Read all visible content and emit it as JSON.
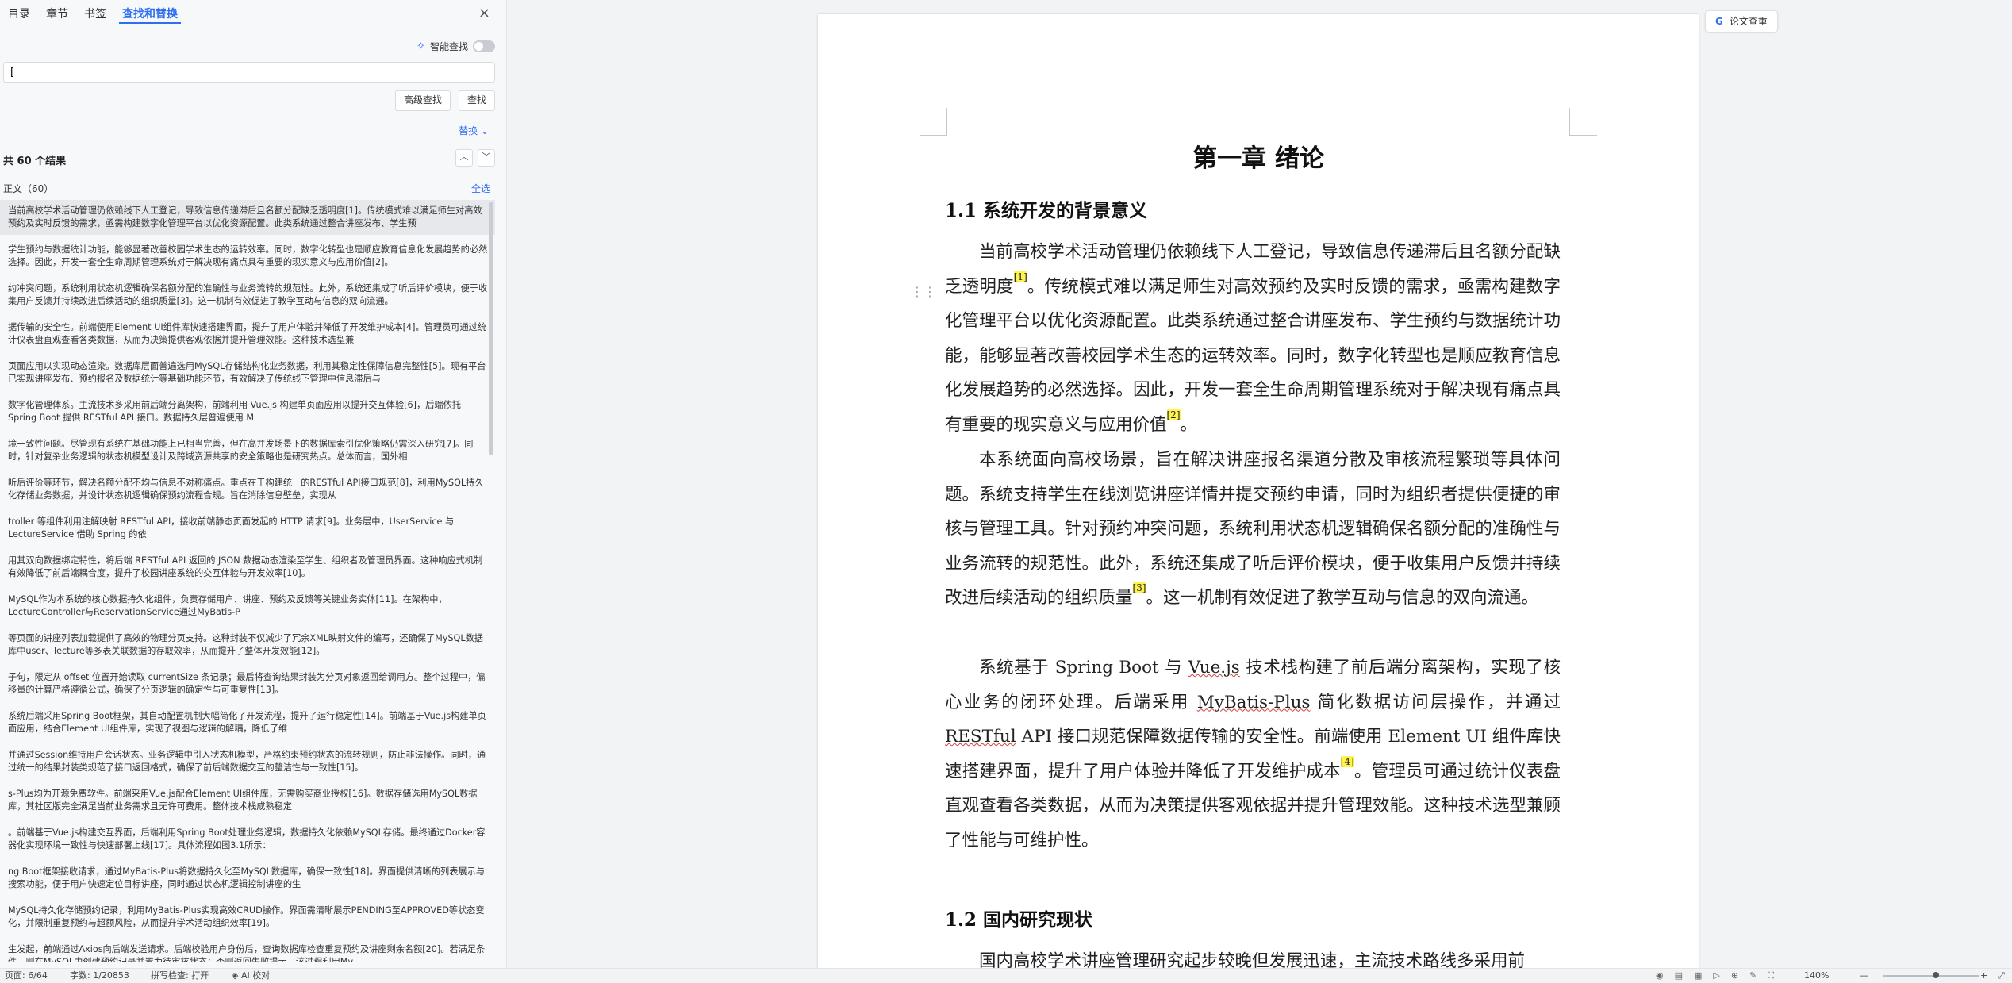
{
  "nav": {
    "tabs": [
      "目录",
      "章节",
      "书签",
      "查找和替换"
    ],
    "active_tab": "查找和替换",
    "close_icon": "×"
  },
  "search": {
    "smart_search_label": "智能查找",
    "query": "[",
    "advanced_label": "高级查找",
    "find_label": "查找",
    "replace_label": "替换",
    "result_count": "共 60 个结果",
    "section_label": "正文（60）",
    "select_all": "全选"
  },
  "results": [
    "当前高校学术活动管理仍依赖线下人工登记，导致信息传递滞后且名额分配缺乏透明度[1]。传统模式难以满足师生对高效预约及实时反馈的需求，亟需构建数字化管理平台以优化资源配置。此类系统通过整合讲座发布、学生预",
    "学生预约与数据统计功能，能够显著改善校园学术生态的运转效率。同时，数字化转型也是顺应教育信息化发展趋势的必然选择。因此，开发一套全生命周期管理系统对于解决现有痛点具有重要的现实意义与应用价值[2]。",
    "约冲突问题，系统利用状态机逻辑确保名额分配的准确性与业务流转的规范性。此外，系统还集成了听后评价模块，便于收集用户反馈并持续改进后续活动的组织质量[3]。这一机制有效促进了教学互动与信息的双向流通。",
    "据传输的安全性。前端使用Element UI组件库快速搭建界面，提升了用户体验并降低了开发维护成本[4]。管理员可通过统计仪表盘直观查看各类数据，从而为决策提供客观依据并提升管理效能。这种技术选型兼",
    "页面应用以实现动态渲染。数据库层面普遍选用MySQL存储结构化业务数据，利用其稳定性保障信息完整性[5]。现有平台已实现讲座发布、预约报名及数据统计等基础功能环节，有效解决了传统线下管理中信息滞后与",
    "数字化管理体系。主流技术多采用前后端分离架构，前端利用 Vue.js 构建单页面应用以提升交互体验[6]，后端依托 Spring Boot 提供 RESTful API 接口。数据持久层普遍使用 M",
    "境一致性问题。尽管现有系统在基础功能上已相当完善，但在高并发场景下的数据库索引优化策略仍需深入研究[7]。同时，针对复杂业务逻辑的状态机模型设计及跨域资源共享的安全策略也是研究热点。总体而言，国外相",
    "听后评价等环节，解决名额分配不均与信息不对称痛点。重点在于构建统一的RESTful API接口规范[8]，利用MySQL持久化存储业务数据，并设计状态机逻辑确保预约流程合规。旨在消除信息壁垒，实现从",
    "troller 等组件利用注解映射 RESTful API，接收前端静态页面发起的 HTTP 请求[9]。业务层中，UserService 与 LectureService 借助 Spring 的依",
    "用其双向数据绑定特性，将后端 RESTful API 返回的 JSON 数据动态渲染至学生、组织者及管理员界面。这种响应式机制有效降低了前后端耦合度，提升了校园讲座系统的交互体验与开发效率[10]。",
    "MySQL作为本系统的核心数据持久化组件，负责存储用户、讲座、预约及反馈等关键业务实体[11]。在架构中，LectureController与ReservationService通过MyBatis-P",
    "等页面的讲座列表加载提供了高效的物理分页支持。这种封装不仅减少了冗余XML映射文件的编写，还确保了MySQL数据库中user、lecture等多表关联数据的存取效率，从而提升了整体开发效能[12]。",
    "子句，限定从 offset 位置开始读取 currentSize 条记录；最后将查询结果封装为分页对象返回给调用方。整个过程中，偏移量的计算严格遵循公式，确保了分页逻辑的确定性与可重复性[13]。",
    "系统后端采用Spring Boot框架，其自动配置机制大幅简化了开发流程，提升了运行稳定性[14]。前端基于Vue.js构建单页面应用，结合Element UI组件库，实现了视图与逻辑的解耦，降低了维",
    "并通过Session维持用户会话状态。业务逻辑中引入状态机模型，严格约束预约状态的流转规则，防止非法操作。同时，通过统一的结果封装类规范了接口返回格式，确保了前后端数据交互的整洁性与一致性[15]。",
    "s-Plus均为开源免费软件。前端采用Vue.js配合Element UI组件库，无需购买商业授权[16]。数据存储选用MySQL数据库，其社区版完全满足当前业务需求且无许可费用。整体技术栈成熟稳定",
    "。前端基于Vue.js构建交互界面，后端利用Spring Boot处理业务逻辑，数据持久化依赖MySQL存储。最终通过Docker容器化实现环境一致性与快速部署上线[17]。具体流程如图3.1所示：",
    "ng Boot框架接收请求，通过MyBatis-Plus将数据持久化至MySQL数据库，确保一致性[18]。界面提供清晰的列表展示与搜索功能，便于用户快速定位目标讲座，同时通过状态机逻辑控制讲座的生",
    "MySQL持久化存储预约记录，利用MyBatis-Plus实现高效CRUD操作。界面需清晰展示PENDING至APPROVED等状态变化，并限制重复预约与超额风险，从而提升学术活动组织效率[19]。",
    "生发起，前端通过Axios向后端发送请求。后端校验用户身份后，查询数据库检查重复预约及讲座剩余名额[20]。若满足条件，则在MySQL中创建预约记录并置为待审核状态；否则返回失败提示。该过程利用My"
  ],
  "document": {
    "chapter_title": "第一章 绪论",
    "sec1_title": "1.1 系统开发的背景意义",
    "p1": [
      "当前高校学术活动管理仍依赖线下人工登记，导致信息传递滞后且名额分配缺乏透明度",
      "[1]",
      "。传统模式难以满足师生对高效预约及实时反馈的需求，亟需构建数字化管理平台以优化资源配置。此类系统通过整合讲座发布、学生预约与数据统计功能，能够显著改善校园学术生态的运转效率。同时，数字化转型也是顺应教育信息化发展趋势的必然选择。因此，开发一套全生命周期管理系统对于解决现有痛点具有重要的现实意义与应用价值",
      "[2]",
      "。"
    ],
    "p2": [
      "本系统面向高校场景，旨在解决讲座报名渠道分散及审核流程繁琐等具体问题。系统支持学生在线浏览讲座详情并提交预约申请，同时为组织者提供便捷的审核与管理工具。针对预约冲突问题，系统利用状态机逻辑确保名额分配的准确性与业务流转的规范性。此外，系统还集成了听后评价模块，便于收集用户反馈并持续改进后续活动的组织质量",
      "[3]",
      "。这一机制有效促进了教学互动与信息的双向流通。"
    ],
    "p3": [
      "系统基于 Spring Boot 与 ",
      "Vue.js",
      " 技术栈构建了前后端分离架构，实现了核心业务的闭环处理。后端采用 ",
      "MyBatis-Plus",
      " 简化数据访问层操作，并通过 ",
      "RESTful",
      " API 接口规范保障数据传输的安全性。前端使用 Element UI 组件库快速搭建界面，提升了用户体验并降低了开发维护成本",
      "[4]",
      "。管理员可通过统计仪表盘直观查看各类数据，从而为决策提供客观依据并提升管理效能。这种技术选型兼顾了性能与可维护性。"
    ],
    "sec2_title": "1.2 国内研究现状",
    "p4": "国内高校学术讲座管理研究起步较晚但发展迅速，主流技术路线多采用前"
  },
  "right": {
    "paper_check": "论文查重"
  },
  "status": {
    "page": "页面: 6/64",
    "words": "字数: 1/20853",
    "spell": "拼写检查: 打开",
    "ai": "AI 校对",
    "zoom": "140%"
  },
  "colors": {
    "accent": "#2e6ff0",
    "highlight": "#fff34d"
  }
}
